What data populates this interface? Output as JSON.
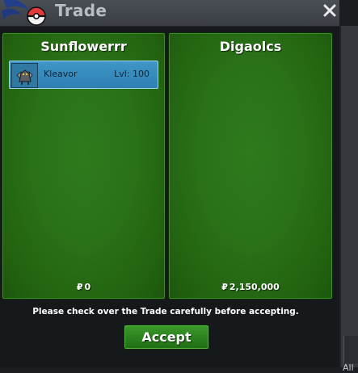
{
  "window": {
    "title": "Trade",
    "close_glyph": "✕"
  },
  "icons": {
    "logo": "pokeball-logo-icon",
    "close": "close-icon",
    "pokedollar": "pokedollar-icon"
  },
  "left_trader": {
    "name": "Sunflowerrr",
    "money_symbol": "₽",
    "money": "0",
    "items": [
      {
        "name": "Kleavor",
        "level": "Lvl: 100"
      }
    ]
  },
  "right_trader": {
    "name": "Digaolcs",
    "money_symbol": "₽",
    "money": "2,150,000"
  },
  "notice": "Please check over the Trade carefully before accepting.",
  "accept_label": "Accept",
  "side_tab_label": "All",
  "colors": {
    "panel_green": "#2a7118",
    "item_blue": "#3f97c7",
    "button_green": "#2d8420"
  }
}
